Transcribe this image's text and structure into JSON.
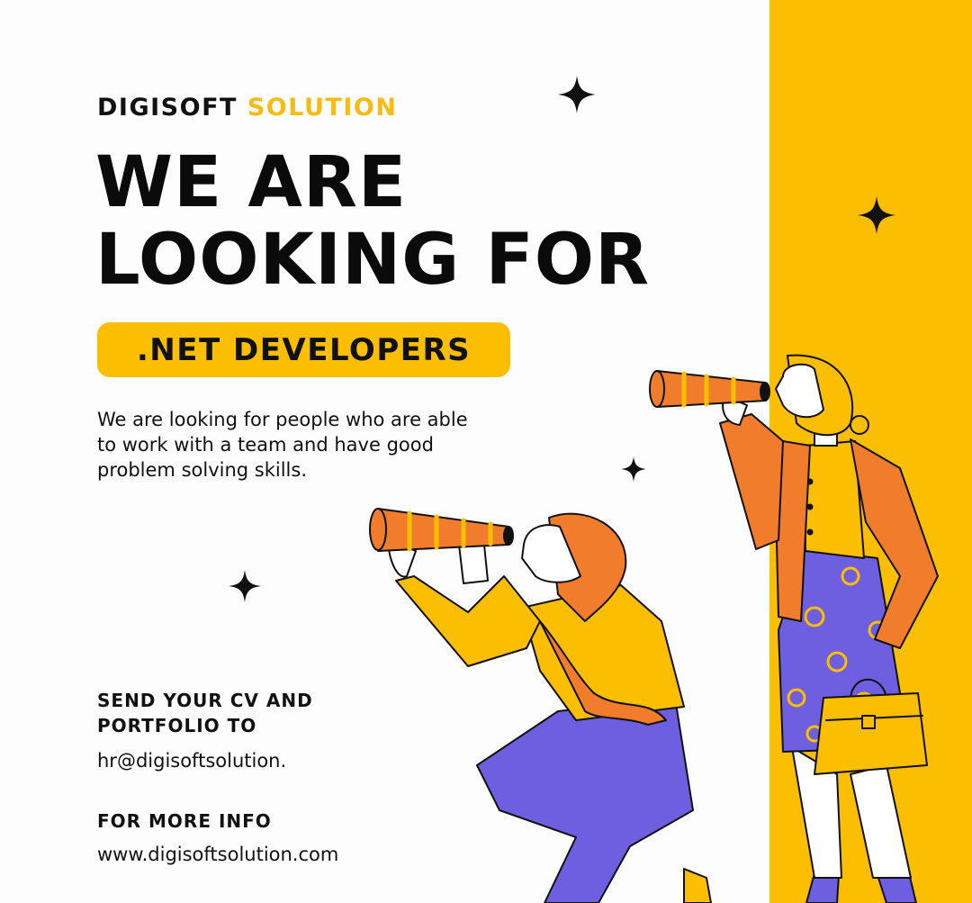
{
  "colors": {
    "accent": "#fbbe00",
    "text": "#111111",
    "jacket": "#f07c2c",
    "pants": "#6e5ee0",
    "sweater": "#fbbe00"
  },
  "brand": {
    "name": "DIGISOFT",
    "accent": "SOLUTION"
  },
  "headline": {
    "line1": "WE ARE",
    "line2": "LOOKING FOR"
  },
  "role": ".NET DEVELOPERS",
  "description": "We are looking for people who are able to work with a team and have good problem solving skills.",
  "cta": {
    "label": "SEND YOUR CV AND PORTFOLIO TO",
    "email": "hr@digisoftsolution."
  },
  "more_info": {
    "label": "FOR MORE INFO",
    "website": "www.digisoftsolution.com"
  },
  "icons": [
    "sparkle-icon",
    "telescope-icon",
    "handbag-icon"
  ]
}
